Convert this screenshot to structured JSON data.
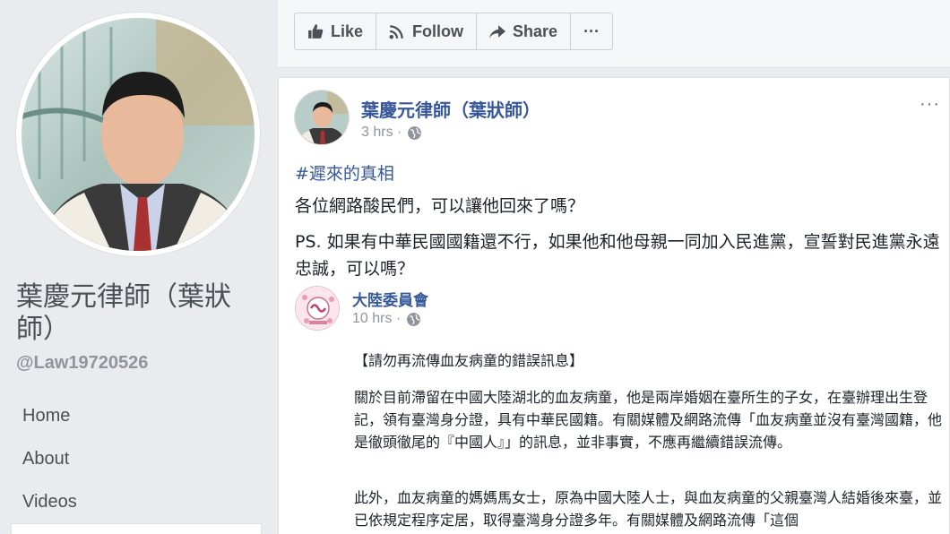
{
  "profile": {
    "name": "葉慶元律師（葉狀師）",
    "handle": "@Law19720526"
  },
  "nav": {
    "items": [
      {
        "label": "Home"
      },
      {
        "label": "About"
      },
      {
        "label": "Videos"
      }
    ]
  },
  "actions": {
    "like": "Like",
    "follow": "Follow",
    "share": "Share",
    "more": "···"
  },
  "post": {
    "author": "葉慶元律師（葉狀師）",
    "time": "3 hrs ·",
    "hashtag": "#遲來的真相",
    "line1": "各位網路酸民們，可以讓他回來了嗎？",
    "line2": "PS. 如果有中華民國國籍還不行，如果他和他母親一同加入民進黨，宣誓對民進黨永遠忠誠，可以嗎？",
    "more": "···",
    "shared": {
      "name": "大陸委員會",
      "time": "10 hrs ·",
      "title": "【請勿再流傳血友病童的錯誤訊息】",
      "para1": "關於目前滯留在中國大陸湖北的血友病童，他是兩岸婚姻在臺所生的子女，在臺辦理出生登記，領有臺灣身分證，具有中華民國籍。有關媒體及網路流傳「血友病童並沒有臺灣國籍，他是徹頭徹尾的『中國人』」的訊息，並非事實，不應再繼續錯誤流傳。",
      "para2": "此外，血友病童的媽媽馬女士，原為中國大陸人士，與血友病童的父親臺灣人結婚後來臺，並已依規定程序定居，取得臺灣身分證多年。有關媒體及網路流傳「這個"
    }
  }
}
